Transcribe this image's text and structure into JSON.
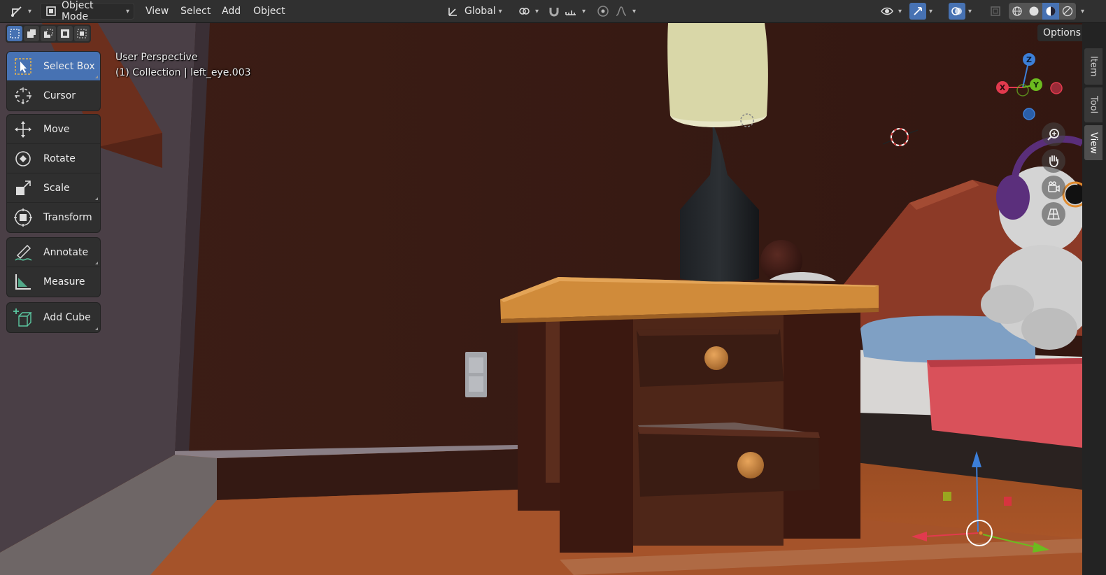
{
  "header": {
    "mode_label": "Object Mode",
    "menus": [
      "View",
      "Select",
      "Add",
      "Object"
    ],
    "orientation_label": "Global"
  },
  "viewport": {
    "options_label": "Options",
    "perspective_label": "User Perspective",
    "collection_label": "(1) Collection | left_eye.003"
  },
  "toolbar": {
    "tools": [
      {
        "label": "Select Box",
        "icon": "select-box-icon",
        "active": true
      },
      {
        "label": "Cursor",
        "icon": "cursor-icon"
      },
      {
        "label": "Move",
        "icon": "move-icon"
      },
      {
        "label": "Rotate",
        "icon": "rotate-icon"
      },
      {
        "label": "Scale",
        "icon": "scale-icon"
      },
      {
        "label": "Transform",
        "icon": "transform-icon"
      },
      {
        "label": "Annotate",
        "icon": "annotate-icon"
      },
      {
        "label": "Measure",
        "icon": "measure-icon"
      },
      {
        "label": "Add Cube",
        "icon": "add-cube-icon"
      }
    ]
  },
  "gizmo": {
    "x": "X",
    "y": "Y",
    "z": "Z"
  },
  "sidebar_tabs": [
    "Item",
    "Tool",
    "View"
  ],
  "colors": {
    "accent": "#4772b3",
    "wall": "#3a1d14",
    "floor": "#a8552b",
    "axis_x": "#e23a4e",
    "axis_y": "#6cbb1f",
    "axis_z": "#3c7fd9"
  }
}
